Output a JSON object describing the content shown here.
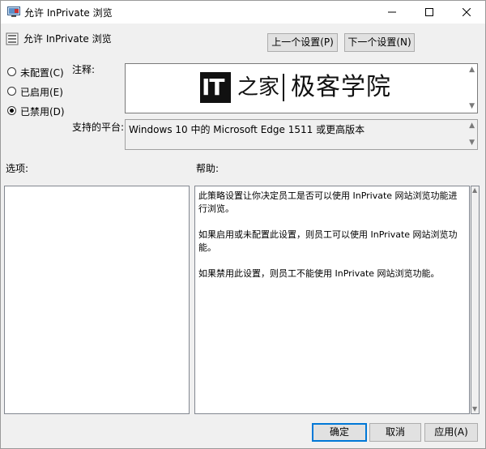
{
  "window": {
    "title": "允许 InPrivate 浏览",
    "minimize_icon": "minimize-icon",
    "maximize_icon": "maximize-icon",
    "close_icon": "close-icon"
  },
  "header": {
    "policy_name": "允许 InPrivate 浏览",
    "prev_button": "上一个设置(P)",
    "next_button": "下一个设置(N)"
  },
  "state": {
    "options": [
      {
        "label": "未配置(C)",
        "selected": false
      },
      {
        "label": "已启用(E)",
        "selected": false
      },
      {
        "label": "已禁用(D)",
        "selected": true
      }
    ]
  },
  "comment": {
    "label": "注释:",
    "value": "",
    "watermark_logo": "IT",
    "watermark_glyph": "之家",
    "watermark_text": "极客学院"
  },
  "supported": {
    "label": "支持的平台:",
    "value": "Windows 10 中的 Microsoft Edge 1511 或更高版本"
  },
  "options_section": {
    "label": "选项:"
  },
  "help_section": {
    "label": "帮助:",
    "paragraphs": [
      "此策略设置让你决定员工是否可以使用 InPrivate 网站浏览功能进行浏览。",
      "如果启用或未配置此设置，则员工可以使用 InPrivate 网站浏览功能。",
      "如果禁用此设置，则员工不能使用 InPrivate 网站浏览功能。"
    ]
  },
  "footer": {
    "ok": "确定",
    "cancel": "取消",
    "apply": "应用(A)"
  }
}
